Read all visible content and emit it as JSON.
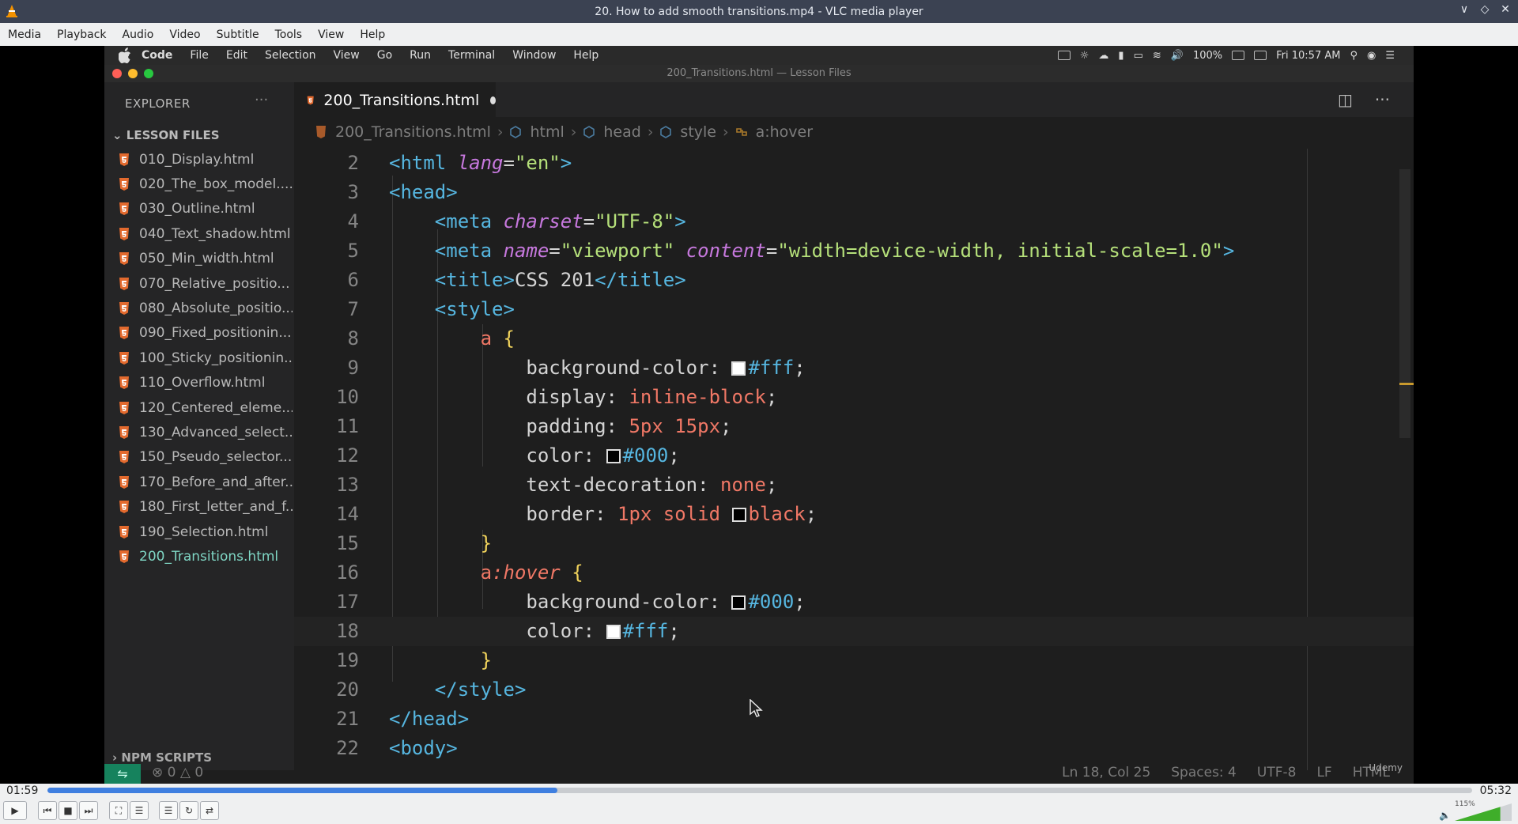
{
  "vlc": {
    "title": "20. How to add smooth transitions.mp4 - VLC media player",
    "menu": [
      "Media",
      "Playback",
      "Audio",
      "Video",
      "Subtitle",
      "Tools",
      "View",
      "Help"
    ],
    "time_current": "01:59",
    "time_total": "05:32",
    "progress_fraction": 0.358,
    "volume_label": "115%",
    "volume_fraction": 0.8
  },
  "mac": {
    "menu": [
      "Code",
      "File",
      "Edit",
      "Selection",
      "View",
      "Go",
      "Run",
      "Terminal",
      "Window",
      "Help"
    ],
    "battery": "100%",
    "clock": "Fri 10:57 AM"
  },
  "vscode": {
    "window_title": "200_Transitions.html — Lesson Files",
    "explorer_title": "EXPLORER",
    "section_title": "LESSON FILES",
    "npm_title": "NPM SCRIPTS",
    "files": [
      "010_Display.html",
      "020_The_box_model....",
      "030_Outline.html",
      "040_Text_shadow.html",
      "050_Min_width.html",
      "070_Relative_positio...",
      "080_Absolute_positio...",
      "090_Fixed_positionin...",
      "100_Sticky_positionin...",
      "110_Overflow.html",
      "120_Centered_eleme...",
      "130_Advanced_select...",
      "150_Pseudo_selector...",
      "170_Before_and_after...",
      "180_First_letter_and_f...",
      "190_Selection.html",
      "200_Transitions.html"
    ],
    "active_tab": "200_Transitions.html",
    "breadcrumb": [
      "200_Transitions.html",
      "html",
      "head",
      "style",
      "a:hover"
    ],
    "line_numbers": [
      "2",
      "3",
      "4",
      "5",
      "6",
      "7",
      "8",
      "9",
      "10",
      "11",
      "12",
      "13",
      "14",
      "15",
      "16",
      "17",
      "18",
      "19",
      "20",
      "21",
      "22"
    ],
    "status": {
      "errors": "0",
      "warnings": "0",
      "position": "Ln 18, Col 25",
      "spaces": "Spaces: 4",
      "encoding": "UTF-8",
      "eol": "LF",
      "language": "HTML",
      "watermark": "Udemy"
    }
  }
}
